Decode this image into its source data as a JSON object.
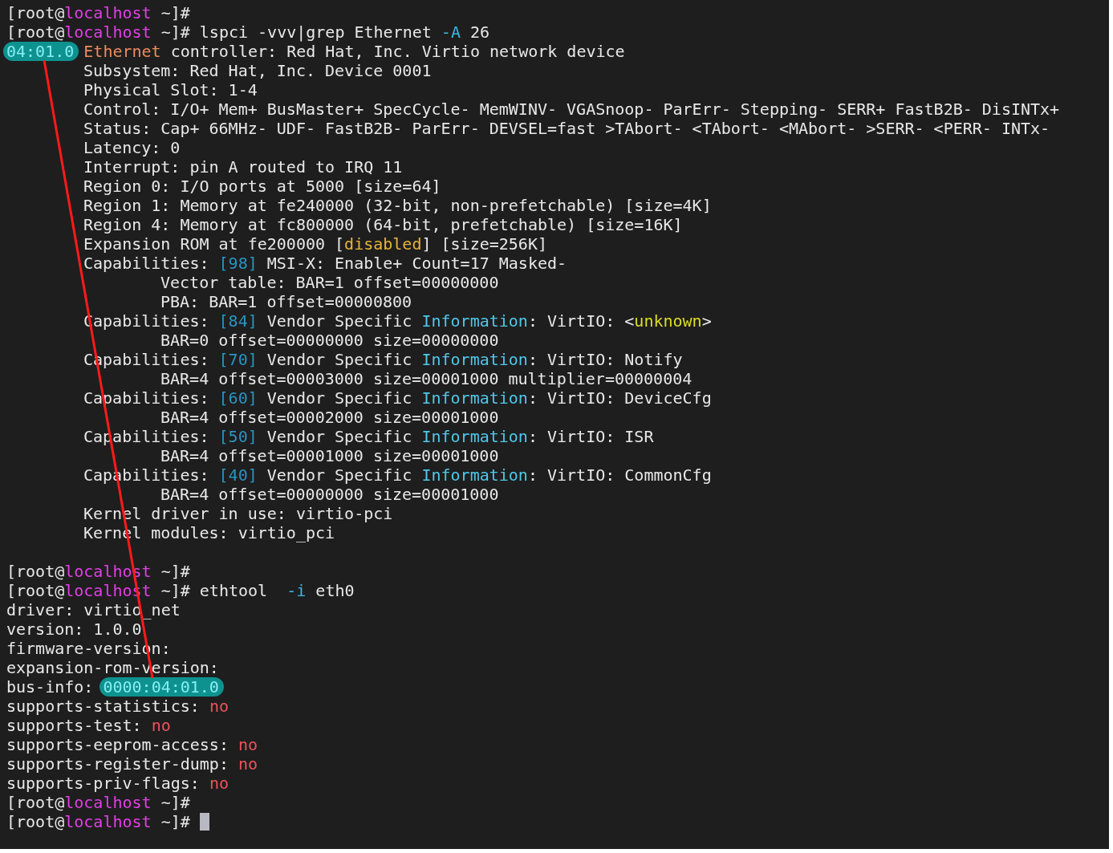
{
  "terminal": {
    "lines": [
      {
        "kind": "top",
        "segments": [
          {
            "kind": "text",
            "text": "[root@"
          },
          {
            "kind": "host",
            "text": "localhost"
          },
          {
            "kind": "text",
            "text": " ~]#"
          }
        ]
      },
      {
        "kind": "top",
        "segments": [
          {
            "kind": "text",
            "text": "[root@"
          },
          {
            "kind": "host",
            "text": "localhost"
          },
          {
            "kind": "text",
            "text": " ~]# lspci -vvv|grep Ethernet "
          },
          {
            "kind": "option",
            "text": "-A"
          },
          {
            "kind": "text",
            "text": " 26"
          }
        ]
      },
      {
        "kind": "top",
        "segments": [
          {
            "kind": "highlight",
            "text": "04:01.0"
          },
          {
            "kind": "match",
            "text": "Ethernet"
          },
          {
            "kind": "text",
            "text": " controller: Red Hat, Inc. Virtio network device"
          }
        ]
      },
      {
        "kind": "detail",
        "segments": [
          {
            "kind": "text",
            "text": "Subsystem: Red Hat, Inc. Device 0001"
          }
        ]
      },
      {
        "kind": "detail",
        "segments": [
          {
            "kind": "text",
            "text": "Physical Slot: 1-4"
          }
        ]
      },
      {
        "kind": "detail",
        "segments": [
          {
            "kind": "text",
            "text": "Control: I/O+ Mem+ BusMaster+ SpecCycle- MemWINV- VGASnoop- ParErr- Stepping- SERR+ FastB2B- DisINTx+"
          }
        ]
      },
      {
        "kind": "detail",
        "segments": [
          {
            "kind": "text",
            "text": "Status: Cap+ 66MHz- UDF- FastB2B- ParErr- DEVSEL=fast >TAbort- <TAbort- <MAbort- >SERR- <PERR- INTx-"
          }
        ]
      },
      {
        "kind": "detail",
        "segments": [
          {
            "kind": "text",
            "text": "Latency: 0"
          }
        ]
      },
      {
        "kind": "detail",
        "segments": [
          {
            "kind": "text",
            "text": "Interrupt: pin A routed to IRQ 11"
          }
        ]
      },
      {
        "kind": "detail",
        "segments": [
          {
            "kind": "text",
            "text": "Region 0: I/O ports at 5000 [size=64]"
          }
        ]
      },
      {
        "kind": "detail",
        "segments": [
          {
            "kind": "text",
            "text": "Region 1: Memory at fe240000 (32-bit, non-prefetchable) [size=4K]"
          }
        ]
      },
      {
        "kind": "detail",
        "segments": [
          {
            "kind": "text",
            "text": "Region 4: Memory at fc800000 (64-bit, prefetchable) [size=16K]"
          }
        ]
      },
      {
        "kind": "detail",
        "segments": [
          {
            "kind": "text",
            "text": "Expansion ROM at fe200000 ["
          },
          {
            "kind": "state",
            "text": "disabled"
          },
          {
            "kind": "text",
            "text": "] [size=256K]"
          }
        ]
      },
      {
        "kind": "detail",
        "segments": [
          {
            "kind": "text",
            "text": "Capabilities: "
          },
          {
            "kind": "index",
            "text": "[98]"
          },
          {
            "kind": "text",
            "text": " MSI-X: Enable+ Count=17 Masked-"
          }
        ]
      },
      {
        "kind": "sub",
        "segments": [
          {
            "kind": "text",
            "text": "Vector table: BAR=1 offset=00000000"
          }
        ]
      },
      {
        "kind": "sub",
        "segments": [
          {
            "kind": "text",
            "text": "PBA: BAR=1 offset=00000800"
          }
        ]
      },
      {
        "kind": "detail",
        "segments": [
          {
            "kind": "text",
            "text": "Capabilities: "
          },
          {
            "kind": "index",
            "text": "[84]"
          },
          {
            "kind": "text",
            "text": " Vendor Specific "
          },
          {
            "kind": "info",
            "text": "Information"
          },
          {
            "kind": "text",
            "text": ": VirtIO: <"
          },
          {
            "kind": "unknown",
            "text": "unknown"
          },
          {
            "kind": "text",
            "text": ">"
          }
        ]
      },
      {
        "kind": "sub",
        "segments": [
          {
            "kind": "text",
            "text": "BAR=0 offset=00000000 size=00000000"
          }
        ]
      },
      {
        "kind": "detail",
        "segments": [
          {
            "kind": "text",
            "text": "Capabilities: "
          },
          {
            "kind": "index",
            "text": "[70]"
          },
          {
            "kind": "text",
            "text": " Vendor Specific "
          },
          {
            "kind": "info",
            "text": "Information"
          },
          {
            "kind": "text",
            "text": ": VirtIO: Notify"
          }
        ]
      },
      {
        "kind": "sub",
        "segments": [
          {
            "kind": "text",
            "text": "BAR=4 offset=00003000 size=00001000 multiplier=00000004"
          }
        ]
      },
      {
        "kind": "detail",
        "segments": [
          {
            "kind": "text",
            "text": "Capabilities: "
          },
          {
            "kind": "index",
            "text": "[60]"
          },
          {
            "kind": "text",
            "text": " Vendor Specific "
          },
          {
            "kind": "info",
            "text": "Information"
          },
          {
            "kind": "text",
            "text": ": VirtIO: DeviceCfg"
          }
        ]
      },
      {
        "kind": "sub",
        "segments": [
          {
            "kind": "text",
            "text": "BAR=4 offset=00002000 size=00001000"
          }
        ]
      },
      {
        "kind": "detail",
        "segments": [
          {
            "kind": "text",
            "text": "Capabilities: "
          },
          {
            "kind": "index",
            "text": "[50]"
          },
          {
            "kind": "text",
            "text": " Vendor Specific "
          },
          {
            "kind": "info",
            "text": "Information"
          },
          {
            "kind": "text",
            "text": ": VirtIO: ISR"
          }
        ]
      },
      {
        "kind": "sub",
        "segments": [
          {
            "kind": "text",
            "text": "BAR=4 offset=00001000 size=00001000"
          }
        ]
      },
      {
        "kind": "detail",
        "segments": [
          {
            "kind": "text",
            "text": "Capabilities: "
          },
          {
            "kind": "index",
            "text": "[40]"
          },
          {
            "kind": "text",
            "text": " Vendor Specific "
          },
          {
            "kind": "info",
            "text": "Information"
          },
          {
            "kind": "text",
            "text": ": VirtIO: CommonCfg"
          }
        ]
      },
      {
        "kind": "sub",
        "segments": [
          {
            "kind": "text",
            "text": "BAR=4 offset=00000000 size=00001000"
          }
        ]
      },
      {
        "kind": "detail",
        "segments": [
          {
            "kind": "text",
            "text": "Kernel driver in use: virtio-pci"
          }
        ]
      },
      {
        "kind": "detail",
        "segments": [
          {
            "kind": "text",
            "text": "Kernel modules: virtio_pci"
          }
        ]
      },
      {
        "kind": "blank"
      },
      {
        "kind": "top",
        "segments": [
          {
            "kind": "text",
            "text": "[root@"
          },
          {
            "kind": "host",
            "text": "localhost"
          },
          {
            "kind": "text",
            "text": " ~]#"
          }
        ]
      },
      {
        "kind": "top",
        "segments": [
          {
            "kind": "text",
            "text": "[root@"
          },
          {
            "kind": "host",
            "text": "localhost"
          },
          {
            "kind": "text",
            "text": " ~]# ethtool  "
          },
          {
            "kind": "option",
            "text": "-i"
          },
          {
            "kind": "text",
            "text": " eth0"
          }
        ]
      },
      {
        "kind": "top",
        "segments": [
          {
            "kind": "text",
            "text": "driver: virtio_net"
          }
        ]
      },
      {
        "kind": "top",
        "segments": [
          {
            "kind": "text",
            "text": "version: 1.0.0"
          }
        ]
      },
      {
        "kind": "top",
        "segments": [
          {
            "kind": "text",
            "text": "firmware-version:"
          }
        ]
      },
      {
        "kind": "top",
        "segments": [
          {
            "kind": "text",
            "text": "expansion-rom-version:"
          }
        ]
      },
      {
        "kind": "top",
        "segments": [
          {
            "kind": "text",
            "text": "bus-info: "
          },
          {
            "kind": "highlight",
            "text": "0000:04:01.0"
          }
        ]
      },
      {
        "kind": "top",
        "segments": [
          {
            "kind": "text",
            "text": "supports-statistics: "
          },
          {
            "kind": "no",
            "text": "no"
          }
        ]
      },
      {
        "kind": "top",
        "segments": [
          {
            "kind": "text",
            "text": "supports-test: "
          },
          {
            "kind": "no",
            "text": "no"
          }
        ]
      },
      {
        "kind": "top",
        "segments": [
          {
            "kind": "text",
            "text": "supports-eeprom-access: "
          },
          {
            "kind": "no",
            "text": "no"
          }
        ]
      },
      {
        "kind": "top",
        "segments": [
          {
            "kind": "text",
            "text": "supports-register-dump: "
          },
          {
            "kind": "no",
            "text": "no"
          }
        ]
      },
      {
        "kind": "top",
        "segments": [
          {
            "kind": "text",
            "text": "supports-priv-flags: "
          },
          {
            "kind": "no",
            "text": "no"
          }
        ]
      },
      {
        "kind": "top",
        "segments": [
          {
            "kind": "text",
            "text": "[root@"
          },
          {
            "kind": "host",
            "text": "localhost"
          },
          {
            "kind": "text",
            "text": " ~]#"
          }
        ]
      },
      {
        "kind": "top",
        "cursor": true,
        "segments": [
          {
            "kind": "text",
            "text": "[root@"
          },
          {
            "kind": "host",
            "text": "localhost"
          },
          {
            "kind": "text",
            "text": " ~]# "
          }
        ]
      }
    ]
  }
}
